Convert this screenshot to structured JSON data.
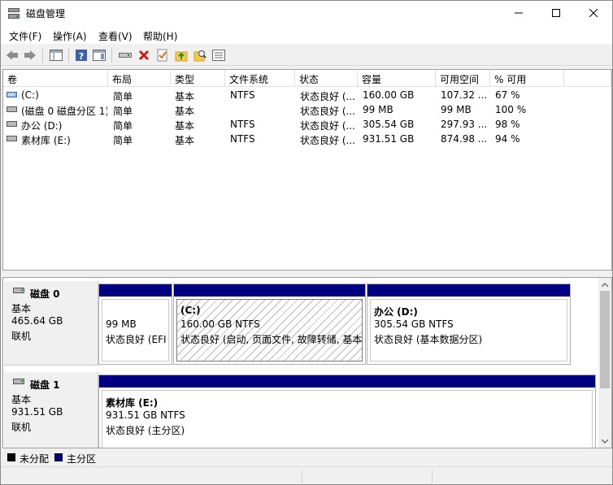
{
  "window": {
    "title": "磁盘管理"
  },
  "menu": [
    {
      "label": "文件(F)"
    },
    {
      "label": "操作(A)"
    },
    {
      "label": "查看(V)"
    },
    {
      "label": "帮助(H)"
    }
  ],
  "toolbar": {
    "buttons": [
      "back-arrow-icon",
      "forward-arrow-icon",
      "console-tree-icon",
      "help-icon",
      "properties-panel-icon",
      "connect-disk-icon",
      "delete-icon",
      "check-icon",
      "up-folder-icon",
      "search-icon",
      "list-view-icon"
    ]
  },
  "volume_list": {
    "columns": [
      "卷",
      "布局",
      "类型",
      "文件系统",
      "状态",
      "容量",
      "可用空间",
      "% 可用"
    ],
    "rows": [
      {
        "volume": "(C:)",
        "layout": "简单",
        "type": "基本",
        "fs": "NTFS",
        "status": "状态良好 (...",
        "capacity": "160.00 GB",
        "free": "107.32 ...",
        "pct": "67 %"
      },
      {
        "volume": "(磁盘 0 磁盘分区 1)",
        "layout": "简单",
        "type": "基本",
        "fs": "",
        "status": "状态良好 (...",
        "capacity": "99 MB",
        "free": "99 MB",
        "pct": "100 %"
      },
      {
        "volume": "办公 (D:)",
        "layout": "简单",
        "type": "基本",
        "fs": "NTFS",
        "status": "状态良好 (...",
        "capacity": "305.54 GB",
        "free": "297.93 ...",
        "pct": "98 %"
      },
      {
        "volume": "素材库 (E:)",
        "layout": "简单",
        "type": "基本",
        "fs": "NTFS",
        "status": "状态良好 (...",
        "capacity": "931.51 GB",
        "free": "874.98 ...",
        "pct": "94 %"
      }
    ]
  },
  "disks": [
    {
      "name": "磁盘 0",
      "type": "基本",
      "size": "465.64 GB",
      "state": "联机",
      "partitions": [
        {
          "title": "",
          "size": "99 MB",
          "status": "状态良好 (EFI"
        },
        {
          "title": "(C:)",
          "size": "160.00 GB NTFS",
          "status": "状态良好 (启动, 页面文件, 故障转储, 基本"
        },
        {
          "title": "办公  (D:)",
          "size": "305.54 GB NTFS",
          "status": "状态良好 (基本数据分区)"
        }
      ]
    },
    {
      "name": "磁盘 1",
      "type": "基本",
      "size": "931.51 GB",
      "state": "联机",
      "partitions": [
        {
          "title": "素材库  (E:)",
          "size": "931.51 GB NTFS",
          "status": "状态良好 (主分区)"
        }
      ]
    }
  ],
  "legend": [
    {
      "label": "未分配",
      "color": "#000000"
    },
    {
      "label": "主分区",
      "color": "#000080"
    }
  ],
  "colors": {
    "partition_bar": "#000080",
    "window_bg": "#f0f0f0"
  }
}
